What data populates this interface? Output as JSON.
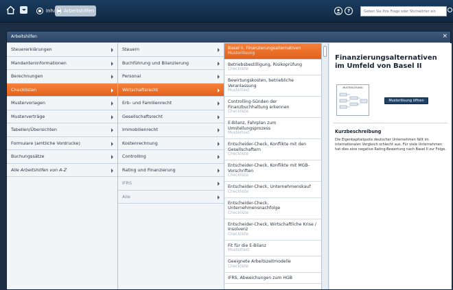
{
  "topbar": {
    "nav": [
      {
        "label": "Inhalte",
        "active": false
      },
      {
        "label": "Arbeitshilfen",
        "active": true
      }
    ],
    "search_placeholder": "Geben Sie Ihre Frage oder Stichwörter ein"
  },
  "panel": {
    "title": "Arbeitshilfen",
    "close": "×"
  },
  "col1": [
    {
      "label": "Steuererklärungen",
      "arrow": true
    },
    {
      "label": "Mandanteninformationen",
      "arrow": true
    },
    {
      "label": "Berechnungen",
      "arrow": true
    },
    {
      "label": "Checklisten",
      "arrow": true,
      "selected": true
    },
    {
      "label": "Mustervorlagen",
      "arrow": true
    },
    {
      "label": "Musterverträge",
      "arrow": true
    },
    {
      "label": "Tabellen/Übersichten",
      "arrow": true
    },
    {
      "label": "Formulare (amtliche Vordrucke)",
      "arrow": true
    },
    {
      "label": "Buchungssätze",
      "arrow": true
    },
    {
      "label": "Alle Arbeitshilfen von A-Z",
      "arrow": true,
      "italic": true
    }
  ],
  "col2": [
    {
      "label": "Steuern",
      "arrow": true
    },
    {
      "label": "Buchführung und Bilanzierung",
      "arrow": true
    },
    {
      "label": "Personal",
      "arrow": true
    },
    {
      "label": "Wirtschaftsrecht",
      "arrow": true,
      "selected": true
    },
    {
      "label": "Erb- und Familienrecht",
      "arrow": true
    },
    {
      "label": "Gesellschaftsrecht",
      "arrow": true
    },
    {
      "label": "Immobilienrecht",
      "arrow": true
    },
    {
      "label": "Kostenrechnung",
      "arrow": true
    },
    {
      "label": "Controlling",
      "arrow": true
    },
    {
      "label": "Rating und Finanzierung",
      "arrow": true
    },
    {
      "label": "IFRS",
      "arrow": true,
      "muted": true
    },
    {
      "label": "Alle",
      "arrow": true,
      "muted": true
    }
  ],
  "col3": [
    {
      "title": "Basel II, Finanzierungsalternativen",
      "type": "Musterlösung",
      "selected": true
    },
    {
      "title": "Betriebsbestilligung, Risikoprüfung",
      "type": "Checkliste"
    },
    {
      "title": "Bewirtungskosten, betriebliche Veranlassung",
      "type": "Mustertext"
    },
    {
      "title": "Controlling-Sünden der Finanzbuchhaltung erkennen",
      "type": "Checkliste"
    },
    {
      "title": "E-Bilanz, Fahrplan zum Umstellungsprozess",
      "type": "Mustertext"
    },
    {
      "title": "Entscheider-Check, Konflikte mit den Gesellschaftern",
      "type": "Checkliste"
    },
    {
      "title": "Entscheider-Check, Konflikte mit MGB-Vorschriften",
      "type": "Checkliste"
    },
    {
      "title": "Entscheider-Check, Unternehmenskauf",
      "type": "Checkliste"
    },
    {
      "title": "Entscheider-Check, Unternehmensnachfolge",
      "type": "Checkliste"
    },
    {
      "title": "Entscheider-Check, Wirtschaftliche Krise / Insolvenz",
      "type": "Checkliste"
    },
    {
      "title": "Fit für die E-Bilanz",
      "type": "Mustertext"
    },
    {
      "title": "Geeignete Arbeitszeitmodelle",
      "type": "Checkliste"
    },
    {
      "title": "IFRS, Abweichungen zum HGB",
      "type": ""
    }
  ],
  "preview": {
    "title": "Finanzierungsalternativen im Umfeld von Basel II",
    "thumb_label": "MUSTERLÖSUNG",
    "open_label": "Musterlösung öffnen",
    "kurz_heading": "Kurzbeschreibung",
    "kurz_text": "Die Eigenkapitalquote deutscher Unternehmen fällt im internationalen Vergleich schlecht aus. Für viele Unternehmen hat dies eine negative Rating-Bewertung nach Basel II zur Folge."
  },
  "colors": {
    "accent": "#e9681f",
    "topbar": "#14324f",
    "panel_header": "#334e6f"
  }
}
